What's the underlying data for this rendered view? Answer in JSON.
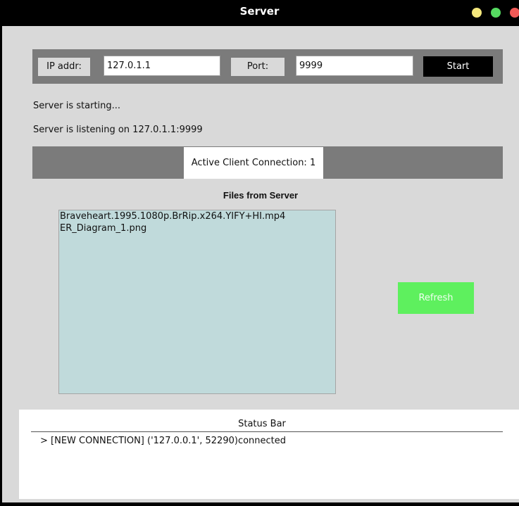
{
  "window": {
    "title": "Server"
  },
  "connection_form": {
    "ip_label": "IP addr:",
    "ip_value": "127.0.1.1",
    "port_label": "Port:",
    "port_value": "9999",
    "start_label": "Start"
  },
  "messages": [
    "Server is starting...",
    "Server is listening on 127.0.1.1:9999"
  ],
  "connections": {
    "label": "Active Client Connection: 1"
  },
  "files": {
    "title": "Files from Server",
    "items": [
      "Braveheart.1995.1080p.BrRip.x264.YIFY+HI.mp4",
      "ER_Diagram_1.png"
    ],
    "refresh_label": "Refresh"
  },
  "status_bar": {
    "title": "Status Bar",
    "lines": [
      "> [NEW CONNECTION] ('127.0.0.1', 52290)connected"
    ]
  },
  "colors": {
    "titlebar": "#000000",
    "panel_bar": "#7b7b7b",
    "file_list_bg": "#c0dadb",
    "refresh_button": "#5ef05e",
    "start_button": "#000000"
  }
}
